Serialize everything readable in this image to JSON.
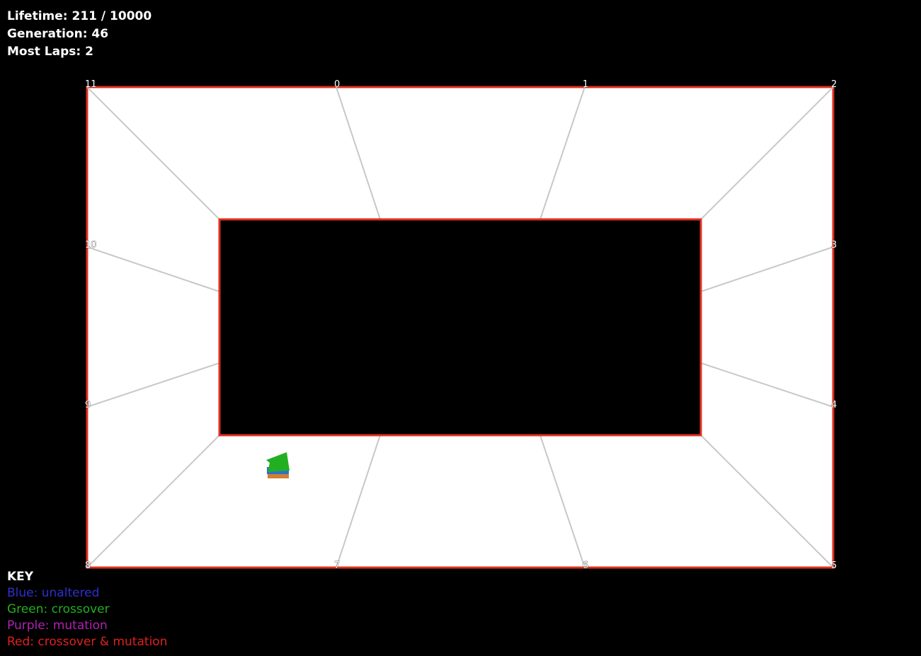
{
  "stats": {
    "lifetime": "Lifetime: 211 / 10000",
    "generation": "Generation: 46",
    "most_laps": "Most Laps: 2"
  },
  "key": {
    "title": "KEY",
    "items": [
      {
        "text": "Blue: unaltered",
        "color": "#2f2fd0"
      },
      {
        "text": "Green: crossover",
        "color": "#22b022"
      },
      {
        "text": "Purple: mutation",
        "color": "#b022b0"
      },
      {
        "text": "Red: crossover & mutation",
        "color": "#e02020"
      }
    ]
  },
  "track": {
    "outer_fill": "#ffffff",
    "inner_fill": "#000000",
    "wall_color": "#e03020",
    "checkpoint_line_color": "#c8c8c8",
    "checkpoints": [
      "0",
      "1",
      "2",
      "3",
      "4",
      "5",
      "6",
      "7",
      "8",
      "9",
      "10",
      "11"
    ]
  },
  "cars": {
    "colors": [
      "#22b022",
      "#2f6fd0",
      "#d08030"
    ]
  }
}
